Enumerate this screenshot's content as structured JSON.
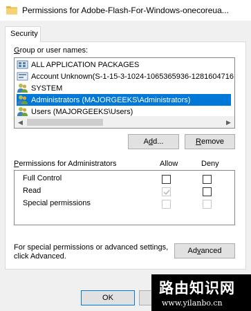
{
  "window": {
    "title": "Permissions for Adobe-Flash-For-Windows-onecoreua..."
  },
  "tabs": [
    {
      "label": "Security",
      "active": true
    }
  ],
  "group_or_user": {
    "label_prefix": "",
    "label_hotkey": "G",
    "label_rest": "roup or user names:",
    "items": [
      {
        "label": "ALL APPLICATION PACKAGES",
        "icon": "package-group-icon",
        "selected": false
      },
      {
        "label": "Account Unknown(S-1-15-3-1024-1065365936-1281604716",
        "icon": "unknown-account-icon",
        "selected": false
      },
      {
        "label": "SYSTEM",
        "icon": "users-group-icon",
        "selected": false
      },
      {
        "label": "Administrators (MAJORGEEKS\\Administrators)",
        "icon": "users-group-icon",
        "selected": true
      },
      {
        "label": "Users (MAJORGEEKS\\Users)",
        "icon": "users-group-icon",
        "selected": false
      }
    ]
  },
  "buttons": {
    "add_prefix": "A",
    "add_hotkey": "d",
    "add_rest": "d...",
    "remove_hotkey": "R",
    "remove_rest": "emove",
    "advanced_prefix": "Ad",
    "advanced_hotkey": "v",
    "advanced_rest": "anced",
    "ok": "OK"
  },
  "permissions": {
    "label_hotkey": "P",
    "label_rest": "ermissions for Administrators",
    "allow_header": "Allow",
    "deny_header": "Deny",
    "rows": [
      {
        "name": "Full Control",
        "allow": false,
        "allow_disabled": false,
        "deny": false,
        "deny_disabled": false
      },
      {
        "name": "Read",
        "allow": true,
        "allow_disabled": true,
        "deny": false,
        "deny_disabled": false
      },
      {
        "name": "Special permissions",
        "allow": false,
        "allow_disabled": true,
        "deny": false,
        "deny_disabled": true
      }
    ]
  },
  "advanced_hint": {
    "line1": "For special permissions or advanced settings,",
    "line2": "click Advanced."
  },
  "watermark": {
    "title": "路由知识网",
    "url": "www.yilanbo.cn"
  }
}
